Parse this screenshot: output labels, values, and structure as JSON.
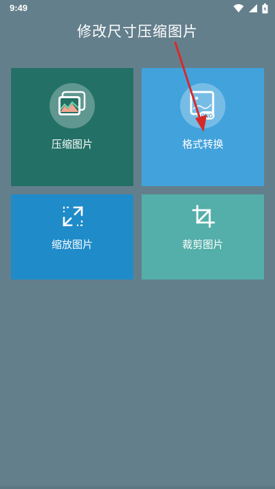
{
  "status_bar": {
    "time": "9:49",
    "icons": [
      "wifi-icon",
      "signal-icon",
      "battery-icon"
    ]
  },
  "title": "修改尺寸压缩图片",
  "tiles": [
    {
      "id": "compress",
      "label": "压缩图片",
      "icon": "image-stack-icon",
      "color": "#237066"
    },
    {
      "id": "format",
      "label": "格式转换",
      "icon": "png-format-icon",
      "icon_text": "PNG",
      "color": "#42a2dc"
    },
    {
      "id": "scale",
      "label": "缩放图片",
      "icon": "resize-arrows-icon",
      "color": "#1f8bc9"
    },
    {
      "id": "crop",
      "label": "裁剪图片",
      "icon": "crop-icon",
      "color": "#54aea9"
    }
  ],
  "annotation": {
    "type": "arrow",
    "color": "#d62a2a",
    "points_to": "format"
  },
  "colors": {
    "background": "#647f8c"
  }
}
